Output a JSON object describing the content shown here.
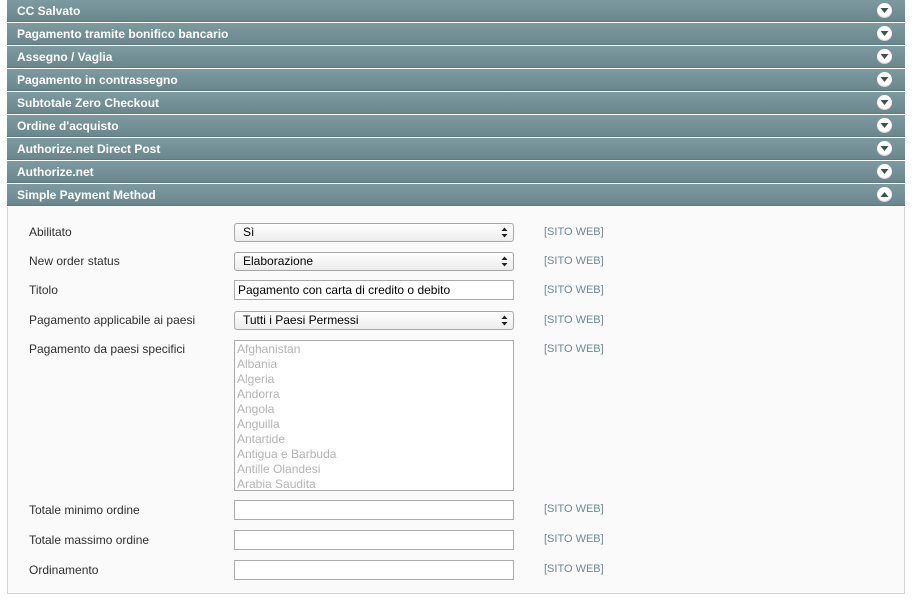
{
  "sections": [
    {
      "title": "CC Salvato"
    },
    {
      "title": "Pagamento tramite bonifico bancario"
    },
    {
      "title": "Assegno / Vaglia"
    },
    {
      "title": "Pagamento in contrassegno"
    },
    {
      "title": "Subtotale Zero Checkout"
    },
    {
      "title": "Ordine d'acquisto"
    },
    {
      "title": "Authorize.net Direct Post"
    },
    {
      "title": "Authorize.net"
    }
  ],
  "open_section": {
    "title": "Simple Payment Method",
    "fields": {
      "enabled": {
        "label": "Abilitato",
        "value": "Sì",
        "scope": "[SITO WEB]"
      },
      "order_status": {
        "label": "New order status",
        "value": "Elaborazione",
        "scope": "[SITO WEB]"
      },
      "title": {
        "label": "Titolo",
        "value": "Pagamento con carta di credito o debito",
        "scope": "[SITO WEB]"
      },
      "allowspecific": {
        "label": "Pagamento applicabile ai paesi",
        "value": "Tutti i Paesi Permessi",
        "scope": "[SITO WEB]"
      },
      "specificcountry": {
        "label": "Pagamento da paesi specifici",
        "scope": "[SITO WEB]",
        "options": [
          "Afghanistan",
          "Albania",
          "Algeria",
          "Andorra",
          "Angola",
          "Anguilla",
          "Antartide",
          "Antigua e Barbuda",
          "Antille Olandesi",
          "Arabia Saudita"
        ]
      },
      "min_total": {
        "label": "Totale minimo ordine",
        "value": "",
        "scope": "[SITO WEB]"
      },
      "max_total": {
        "label": "Totale massimo ordine",
        "value": "",
        "scope": "[SITO WEB]"
      },
      "sort_order": {
        "label": "Ordinamento",
        "value": "",
        "scope": "[SITO WEB]"
      }
    }
  },
  "colors": {
    "header_bg": "#7090a0",
    "scope_text": "#6f8992",
    "panel_bg": "#fafafa"
  },
  "icons": {
    "collapsed": "chevron-down-circle-icon",
    "expanded": "chevron-up-circle-icon",
    "select": "updown-arrows-icon"
  }
}
